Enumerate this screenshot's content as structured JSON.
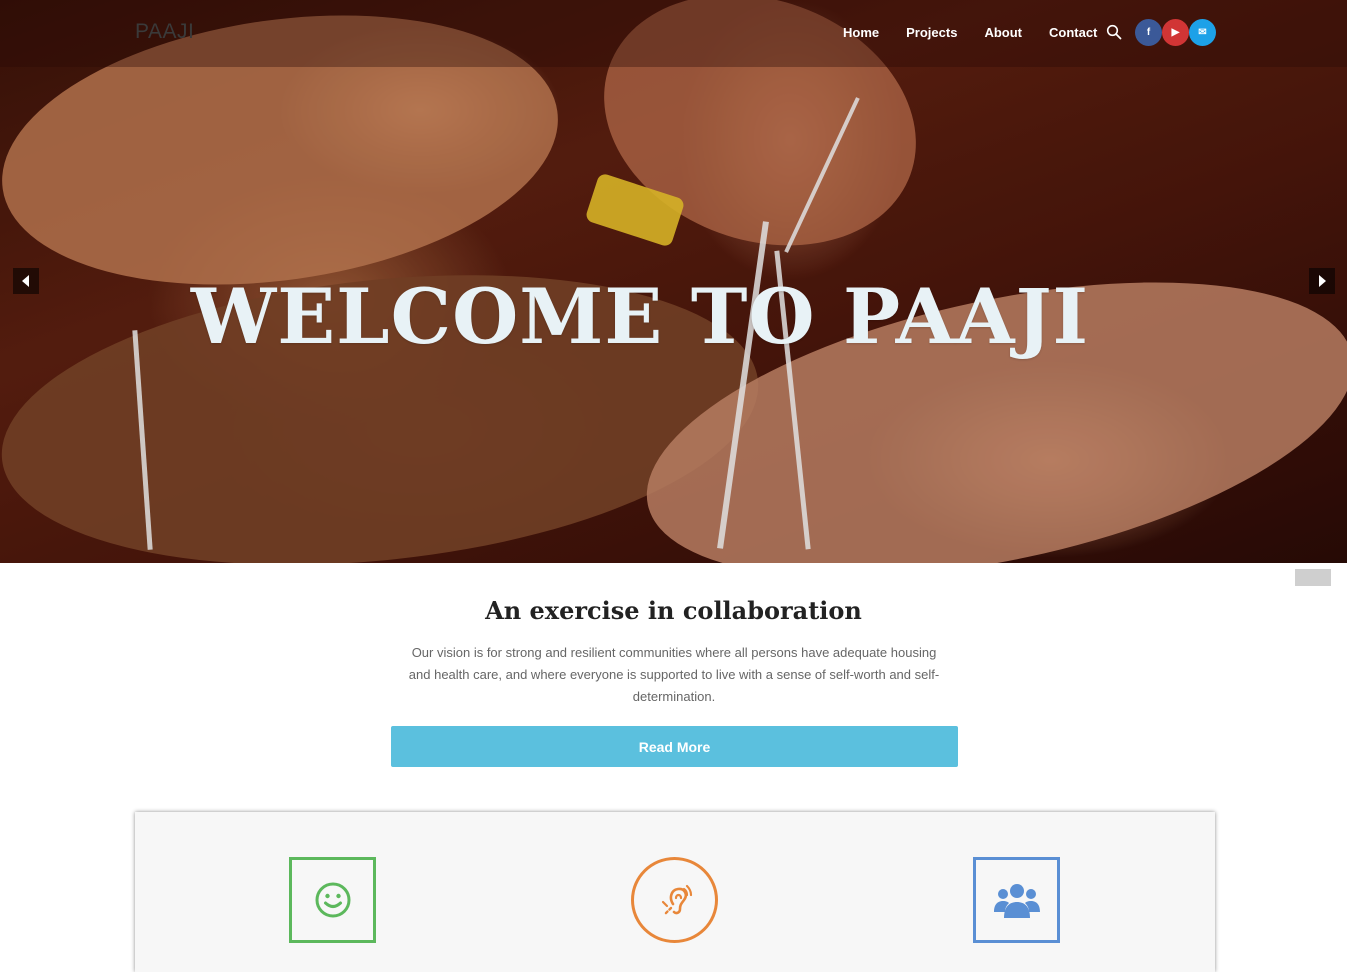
{
  "brand": {
    "logo": "PAAJI"
  },
  "nav": {
    "items": [
      "Home",
      "Projects",
      "About",
      "Contact"
    ]
  },
  "social": {
    "facebook": "f",
    "youtube": "▶",
    "email": "✉"
  },
  "hero": {
    "title": "WELCOME TO PAAJI"
  },
  "intro": {
    "title": "An exercise in collaboration",
    "text": "Our vision is for strong and resilient communities where all persons have adequate housing and health care, and where everyone is supported to live with a sense of self-worth and self-determination.",
    "button": "Read More"
  },
  "colors": {
    "accent_button": "#5bc0de",
    "feature_green": "#5cb85c",
    "feature_orange": "#e8873a",
    "feature_blue": "#5a8fd4"
  },
  "icons": {
    "feature_1": "smile-icon",
    "feature_2": "hearing-icon",
    "feature_3": "users-icon"
  }
}
